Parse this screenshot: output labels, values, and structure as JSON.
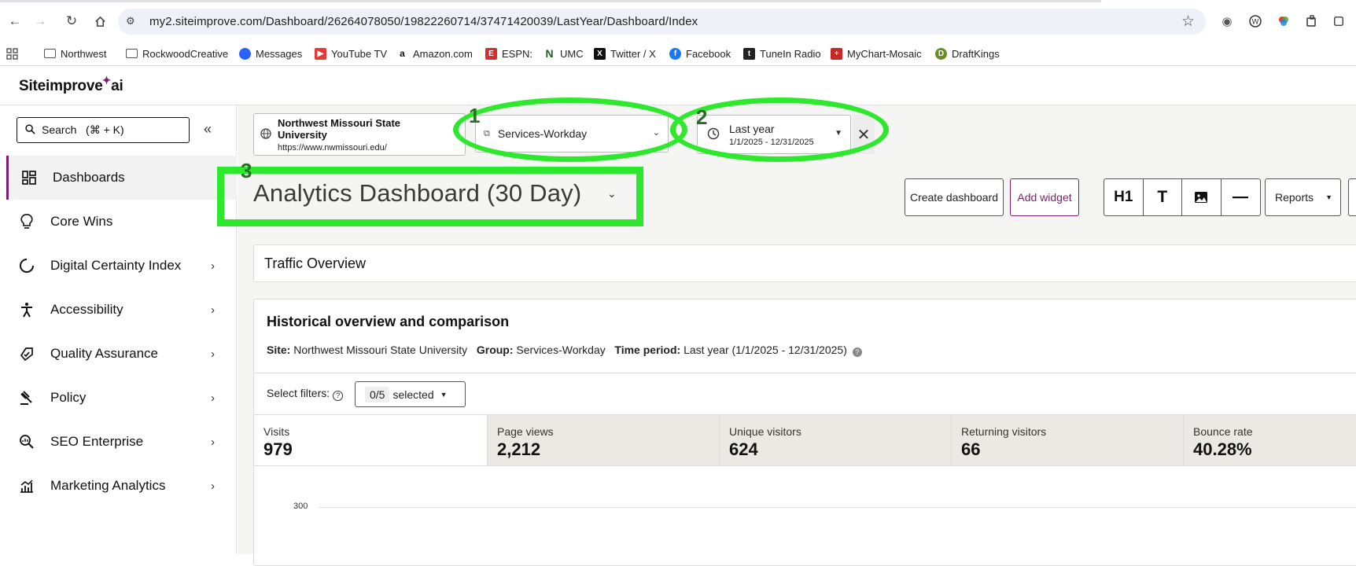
{
  "browser": {
    "url": "my2.siteimprove.com/Dashboard/26264078050/19822260714/37471420039/LastYear/Dashboard/Index",
    "bookmarks": [
      "Northwest",
      "RockwoodCreative",
      "Messages",
      "YouTube TV",
      "Amazon.com",
      "ESPN:",
      "UMC",
      "Twitter / X",
      "Facebook",
      "TuneIn Radio",
      "MyChart-Mosaic",
      "DraftKings"
    ]
  },
  "app": {
    "logo_text": "Siteimprove",
    "logo_suffix": "ai"
  },
  "sidebar": {
    "search_label": "Search   (⌘ + K)",
    "items": [
      {
        "label": "Dashboards",
        "icon": "dashboard-icon",
        "active": true
      },
      {
        "label": "Core Wins",
        "icon": "lightbulb-icon"
      },
      {
        "label": "Digital Certainty Index",
        "icon": "gauge-icon"
      },
      {
        "label": "Accessibility",
        "icon": "accessibility-icon"
      },
      {
        "label": "Quality Assurance",
        "icon": "quality-icon"
      },
      {
        "label": "Policy",
        "icon": "gavel-icon"
      },
      {
        "label": "SEO Enterprise",
        "icon": "seo-icon"
      },
      {
        "label": "Marketing Analytics",
        "icon": "analytics-icon"
      }
    ]
  },
  "filters": {
    "site_name": "Northwest Missouri State University",
    "site_url": "https://www.nwmissouri.edu/",
    "group": "Services-Workday",
    "date_label": "Last year",
    "date_range": "1/1/2025 - 12/31/2025"
  },
  "dashboard": {
    "title": "Analytics Dashboard (30 Day)",
    "create_label": "Create dashboard",
    "add_widget_label": "Add widget",
    "h1_label": "H1",
    "text_label": "T",
    "reports_label": "Reports"
  },
  "traffic_title": "Traffic Overview",
  "card": {
    "title": "Historical overview and comparison",
    "site_key": "Site:",
    "site_val": "Northwest Missouri State University",
    "group_key": "Group:",
    "group_val": "Services-Workday",
    "period_key": "Time period:",
    "period_val": "Last year (1/1/2025 - 12/31/2025)",
    "filters_label": "Select filters:",
    "filter_count": "0/5",
    "filter_selected": "selected",
    "metrics": [
      {
        "label": "Visits",
        "value": "979"
      },
      {
        "label": "Page views",
        "value": "2,212"
      },
      {
        "label": "Unique visitors",
        "value": "624"
      },
      {
        "label": "Returning visitors",
        "value": "66"
      },
      {
        "label": "Bounce rate",
        "value": "40.28%"
      }
    ],
    "y_tick": "300"
  },
  "annotations": [
    "1",
    "2",
    "3"
  ],
  "colors": {
    "accent": "#7b1f6a",
    "annotation": "#2ee82e"
  }
}
